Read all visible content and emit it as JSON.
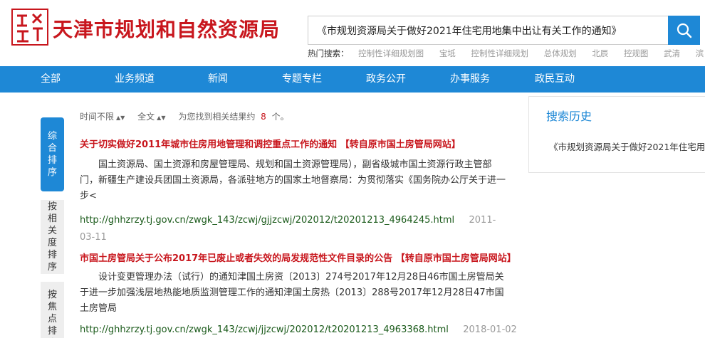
{
  "header": {
    "logo_title": "天津市规划和自然资源局",
    "search_value": "《市规划资源局关于做好2021年住宅用地集中出让有关工作的通知》",
    "hot_label": "热门搜索：",
    "hot_items": [
      "控制性详细规划图",
      "宝坻",
      "控制性详细规划",
      "总体规划",
      "北辰",
      "控规图",
      "武清",
      "滨"
    ]
  },
  "nav": {
    "items": [
      "全部",
      "业务频道",
      "新闻",
      "专题专栏",
      "政务公开",
      "办事服务",
      "政民互动"
    ]
  },
  "side_tabs": [
    "综合排序",
    "按相关度排序",
    "按焦点排序"
  ],
  "filter": {
    "time_label": "时间不限",
    "scope_label": "全文",
    "found_prefix": "为您找到相关结果约",
    "found_count": "8",
    "found_suffix": "个。"
  },
  "results": [
    {
      "title": "关于切实做好2011年城市住房用地管理和调控重点工作的通知 【转自原市国土房管局网站】",
      "snippet": "国土资源局、国土资源和房屋管理局、规划和国土资源管理局），副省级城市国土资源行政主管部门，新疆生产建设兵团国土资源局，各派驻地方的国家土地督察局：为贯彻落实《国务院办公厅关于进一步<",
      "url": "http://ghhzrzy.tj.gov.cn/zwgk_143/zcwj/gjjzcwj/202012/t20201213_4964245.html",
      "date": "2011-03-11"
    },
    {
      "title": "市国土房管局关于公布2017年已废止或者失效的局发规范性文件目录的公告 【转自原市国土房管局网站】",
      "snippet": "设计变更管理办法（试行）的通知津国土房资〔2013〕274号2017年12月28日46市国土房管局关于进一步加强浅层地热能地质监测管理工作的通知津国土房热〔2013〕288号2017年12月28日47市国土房管局",
      "url": "http://ghhzrzy.tj.gov.cn/zwgk_143/zcwj/jjzcwj/202012/t20201213_4963368.html",
      "date": "2018-01-02"
    }
  ],
  "history": {
    "title": "搜索历史",
    "item": "《市规划资源局关于做好2021年住宅用"
  },
  "colors": {
    "accent": "#1e88d6",
    "brand_red": "#c8161d"
  }
}
